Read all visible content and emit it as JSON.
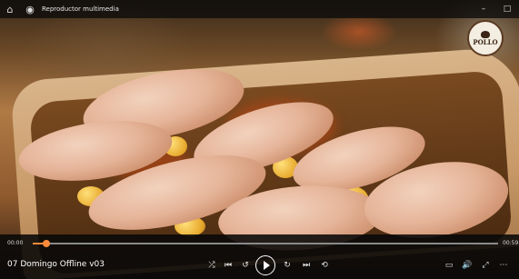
{
  "window": {
    "title": "Reproductor multimedia",
    "home_icon": "home-icon",
    "app_icon": "media-player-icon",
    "minimize_label": "–",
    "maximize_label": "□"
  },
  "watermark": {
    "brand": "POLLO"
  },
  "playback": {
    "current_time": "00:00",
    "duration": "00:59",
    "progress": 0.03,
    "accent_color": "#ff8a3a"
  },
  "media": {
    "title": "07 Domingo Offline v03"
  },
  "controls": {
    "shuffle": "⤮",
    "previous": "⏮",
    "rewind": "↺",
    "forward": "↻",
    "next": "⏭",
    "repeat": "⟲",
    "miniplayer": "▭",
    "volume": "🔊",
    "fullscreen": "⤢",
    "more": "⋯"
  }
}
